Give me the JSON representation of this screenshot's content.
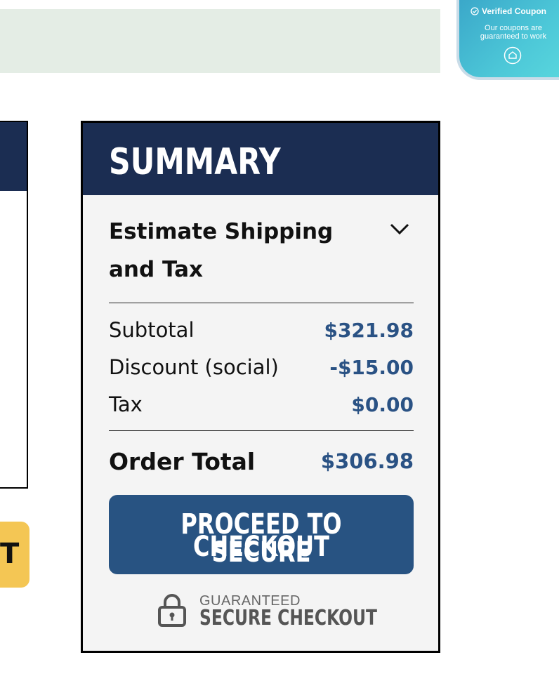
{
  "coupon_badge": {
    "title": "Verified Coupon",
    "subtitle": "Our coupons are guaranteed to work",
    "check_icon": "check-circle-icon",
    "shield_icon": "shield-icon"
  },
  "left_button": {
    "label": "T"
  },
  "summary": {
    "title": "SUMMARY",
    "estimate_shipping": "Estimate Shipping and Tax",
    "rows": [
      {
        "label": "Subtotal",
        "value": "$321.98"
      },
      {
        "label": "Discount (social)",
        "value": "-$15.00"
      },
      {
        "label": "Tax",
        "value": "$0.00"
      }
    ],
    "order_total": {
      "label": "Order Total",
      "value": "$306.98"
    },
    "checkout_button": {
      "line1": "PROCEED TO SECURE",
      "line2": "CHECKOUT"
    },
    "secure_badge": {
      "small": "GUARANTEED",
      "big": "SECURE CHECKOUT"
    }
  },
  "colors": {
    "header_navy": "#1b2d52",
    "button_blue": "#285382",
    "value_blue": "#2a5284",
    "notice_bg": "#e4ede5",
    "yellow": "#f4c654"
  }
}
